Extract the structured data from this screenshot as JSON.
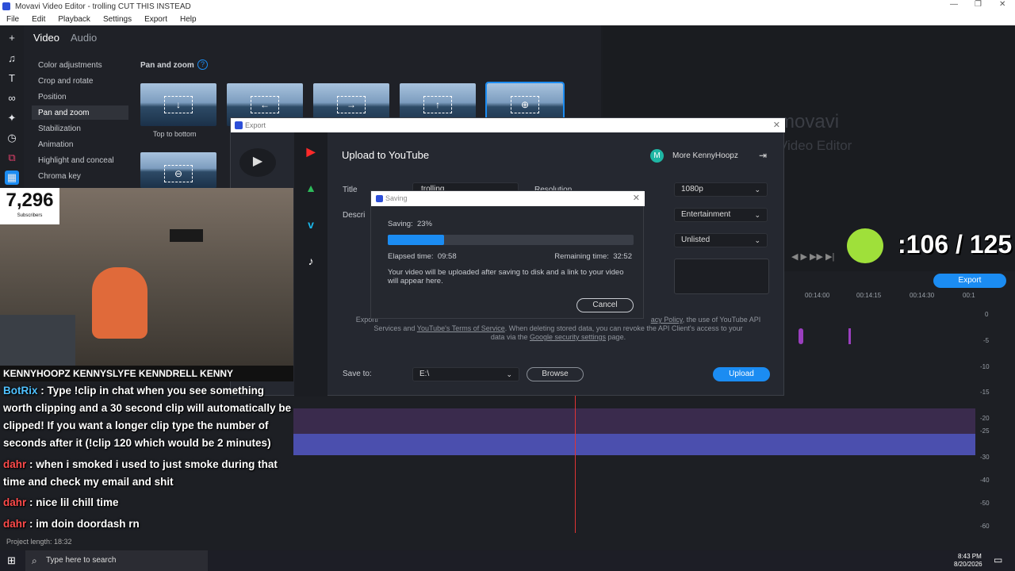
{
  "window": {
    "title": "Movavi Video Editor - trolling CUT THIS INSTEAD"
  },
  "menu": [
    "File",
    "Edit",
    "Playback",
    "Settings",
    "Export",
    "Help"
  ],
  "editor": {
    "tabs": [
      "Video",
      "Audio"
    ],
    "sidebar": [
      "Color adjustments",
      "Crop and rotate",
      "Position",
      "Pan and zoom",
      "Stabilization",
      "Animation",
      "Highlight and conceal",
      "Chroma key"
    ],
    "section_title": "Pan and zoom",
    "thumb_caption": "Top to bottom"
  },
  "preview": {
    "brand": "movavi",
    "brand_sub": "Video Editor"
  },
  "export_dialog": {
    "title": "Export",
    "heading": "Upload to YouTube",
    "account_initial": "M",
    "account": "More KennyHoopz",
    "title_label": "Title",
    "title_value": "trolling",
    "desc_label": "Descri",
    "resolution_label": "Resolution",
    "resolution": "1080p",
    "category": "Entertainment",
    "privacy": "Unlisted",
    "legal_line1": "Exporti",
    "legal_policy": "acy Policy",
    "legal_line1b": ", the use of YouTube API",
    "legal_line2a": "Services and",
    "legal_tos": "YouTube's Terms of Service",
    "legal_line2b": ". When deleting stored data, you can revoke the API Client's access to your",
    "legal_line3a": "data via the",
    "legal_security": "Google security settings",
    "legal_line3b": "page.",
    "save_to_label": "Save to:",
    "save_to_value": "E:\\",
    "browse": "Browse",
    "upload": "Upload"
  },
  "saving_dialog": {
    "title": "Saving",
    "saving_label": "Saving:",
    "progress_percent": 23,
    "progress_text": "23%",
    "elapsed_label": "Elapsed time:",
    "elapsed": "09:58",
    "remaining_label": "Remaining time:",
    "remaining": "32:52",
    "message": "Your video will be uploaded after saving to disk and a link to your video will appear here.",
    "cancel": "Cancel"
  },
  "stream": {
    "subscribers": "7,296",
    "subscribers_label": "Subscribers",
    "socials": "KENNYHOOPZ  KENNYSLYFE  KENNDRELL  KENNY",
    "counter": ":106 / 125",
    "chat": [
      {
        "user": "BotRix",
        "text": ": Type !clip in chat when you see something worth clipping and a 30 second clip will automatically be clipped! If you want a longer clip type the number of seconds after it (!clip 120 which would be 2 minutes)"
      },
      {
        "user": "dahr",
        "text": ": when i smoked i used to just smoke during that time and check my email and shit"
      },
      {
        "user": "dahr",
        "text": ": nice lil chill time"
      },
      {
        "user": "dahr",
        "text": ": im doin doordash rn"
      }
    ]
  },
  "timeline": {
    "export_button": "Export",
    "ruler": [
      "00:14:00",
      "00:14:15",
      "00:14:30",
      "00:1"
    ],
    "levels": [
      "0",
      "-5",
      "-10",
      "-15",
      "-20",
      "-25",
      "-30",
      "-40",
      "-50",
      "-60"
    ],
    "project_length": "Project length: 18:32"
  },
  "taskbar": {
    "search_placeholder": "Type here to search",
    "time": "8:43 PM",
    "date": "8/20/2026"
  }
}
